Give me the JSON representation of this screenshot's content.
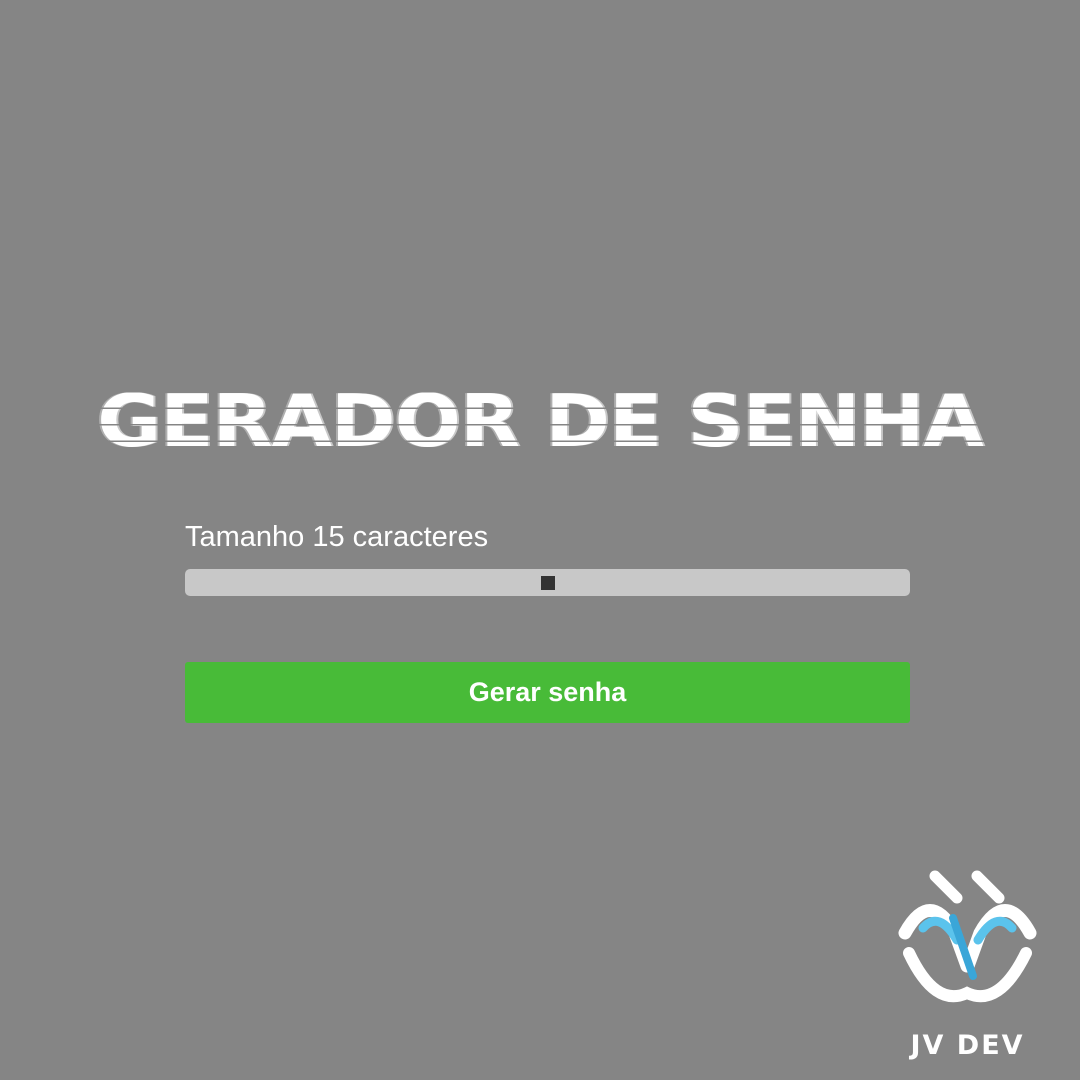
{
  "app": {
    "title": "GERADOR DE SENHA"
  },
  "length": {
    "prefix": "Tamanho ",
    "value": "15",
    "suffix": " caracteres",
    "slider_fraction": 0.5
  },
  "actions": {
    "generate_label": "Gerar senha"
  },
  "brand": {
    "name": "JV DEV",
    "logo_icon": "jv-dev-logo-icon"
  },
  "colors": {
    "background": "#858585",
    "accent_green": "#48bb38",
    "track": "#c8c8c8",
    "thumb": "#333333",
    "logo_blue": "#5bc3ec"
  }
}
